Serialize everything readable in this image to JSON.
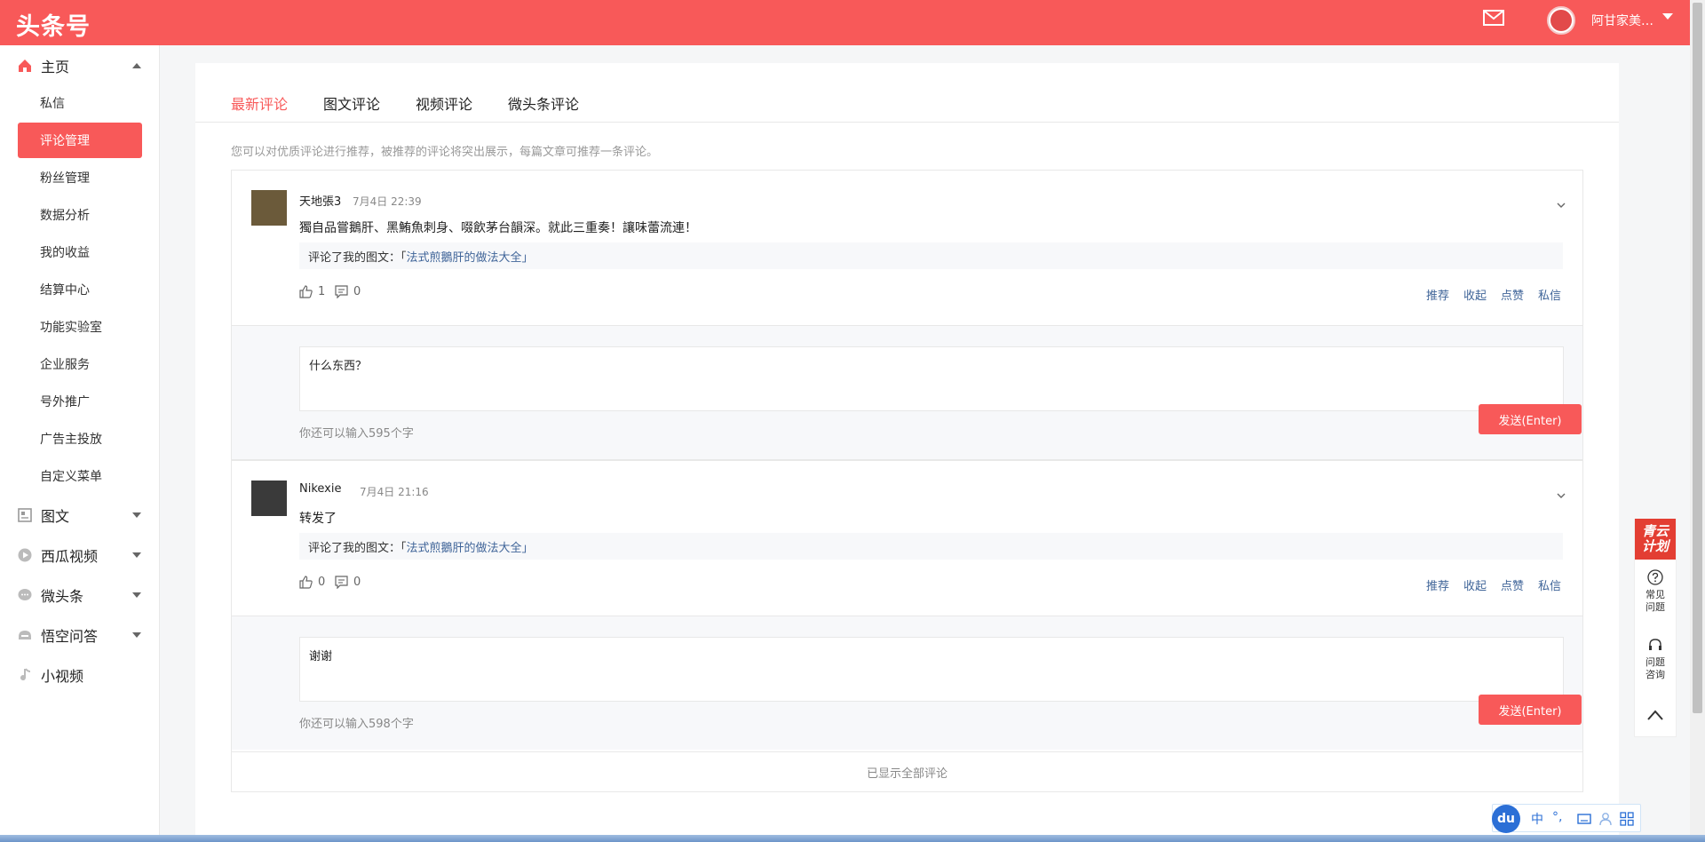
{
  "header": {
    "logo": "头条号",
    "username": "阿甘家美…",
    "brand_color": "#f85959"
  },
  "sidebar": {
    "home": {
      "label": "主页",
      "icon": "home-icon"
    },
    "home_items": [
      {
        "label": "私信"
      },
      {
        "label": "评论管理",
        "active": true
      },
      {
        "label": "粉丝管理"
      },
      {
        "label": "数据分析"
      },
      {
        "label": "我的收益"
      },
      {
        "label": "结算中心"
      },
      {
        "label": "功能实验室"
      },
      {
        "label": "企业服务"
      },
      {
        "label": "号外推广"
      },
      {
        "label": "广告主投放"
      },
      {
        "label": "自定义菜单"
      }
    ],
    "sections": [
      {
        "label": "图文",
        "icon": "article-icon"
      },
      {
        "label": "西瓜视频",
        "icon": "play-icon"
      },
      {
        "label": "微头条",
        "icon": "chat-icon"
      },
      {
        "label": "悟空问答",
        "icon": "qa-icon"
      },
      {
        "label": "小视频",
        "icon": "music-note-icon"
      }
    ]
  },
  "tabs": [
    {
      "label": "最新评论",
      "active": true
    },
    {
      "label": "图文评论"
    },
    {
      "label": "视频评论"
    },
    {
      "label": "微头条评论"
    }
  ],
  "tip": "您可以对优质评论进行推荐，被推荐的评论将突出展示，每篇文章可推荐一条评论。",
  "comments": [
    {
      "author": "天地張3",
      "time": "7月4日 22:39",
      "text": "獨自品嘗鵝肝、黑鮪魚刺身、啜飲茅台韻深。就此三重奏！讓味蕾流連！",
      "ref_prefix": "评论了我的图文：「",
      "ref_title": "法式煎鵝肝的做法大全",
      "ref_suffix": "」",
      "likes": "1",
      "replies": "0",
      "reply_text": "什么东西？",
      "remaining": "你还可以输入595个字"
    },
    {
      "author": "Nikexie",
      "time": "7月4日 21:16",
      "text": "转发了",
      "ref_prefix": "评论了我的图文：「",
      "ref_title": "法式煎鵝肝的做法大全",
      "ref_suffix": "」",
      "likes": "0",
      "replies": "0",
      "reply_text": "谢谢",
      "remaining": "你还可以输入598个字"
    }
  ],
  "actions": {
    "recommend": "推荐",
    "collapse": "收起",
    "like": "点赞",
    "message": "私信",
    "send": "发送(Enter)"
  },
  "all_shown": "已显示全部评论",
  "float_panel": {
    "qingyun_line1": "青云",
    "qingyun_line2": "计划",
    "faq_line1": "常见",
    "faq_line2": "问题",
    "consult_line1": "问题",
    "consult_line2": "咨询"
  },
  "ime": {
    "logo": "du",
    "lang": "中",
    "punct": "°,"
  }
}
